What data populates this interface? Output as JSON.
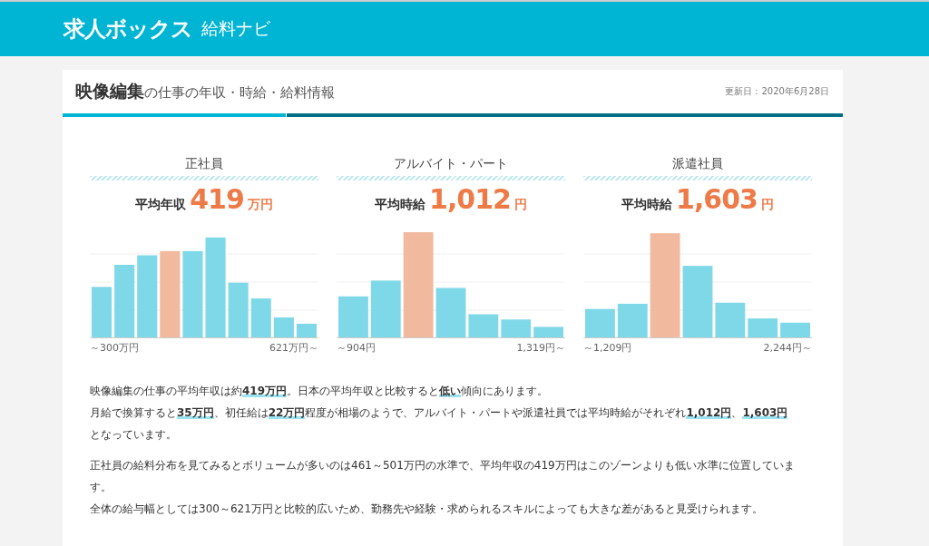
{
  "header": {
    "logo": "求人ボックス",
    "service": "給料ナビ"
  },
  "page_title": {
    "job": "映像編集",
    "suffix": "の仕事の年収・時給・給料情報",
    "updated": "更新日：2020年6月28日"
  },
  "employment_types": [
    {
      "name": "正社員",
      "average_label": "平均年収",
      "amount": "419",
      "unit": "万円",
      "axis_min": "～300万円",
      "axis_max": "621万円～"
    },
    {
      "name": "アルバイト・パート",
      "average_label": "平均時給",
      "amount": "1,012",
      "unit": "円",
      "axis_min": "～904円",
      "axis_max": "1,319円～"
    },
    {
      "name": "派遣社員",
      "average_label": "平均時給",
      "amount": "1,603",
      "unit": "円",
      "axis_min": "～1,209円",
      "axis_max": "2,244円～"
    }
  ],
  "paragraphs": [
    [
      "映像編集の仕事の平均年収は約**419万円**。日本の平均年収と比較すると**低い**傾向にあります。",
      "月給で換算すると**35万円**、初任給は**22万円**程度が相場のようで、アルバイト・パートや派遣社員では平均時給がそれぞれ**1,012円**、**1,603円**となっています。"
    ],
    [
      "正社員の給料分布を見てみるとボリュームが多いのは461～501万円の水準で、平均年収の419万円はこのゾーンよりも低い水準に位置しています。",
      "全体の給与幅としては300～621万円と比較的広いため、勤務先や経験・求められるスキルによっても大きな差があると見受けられます。"
    ]
  ]
}
